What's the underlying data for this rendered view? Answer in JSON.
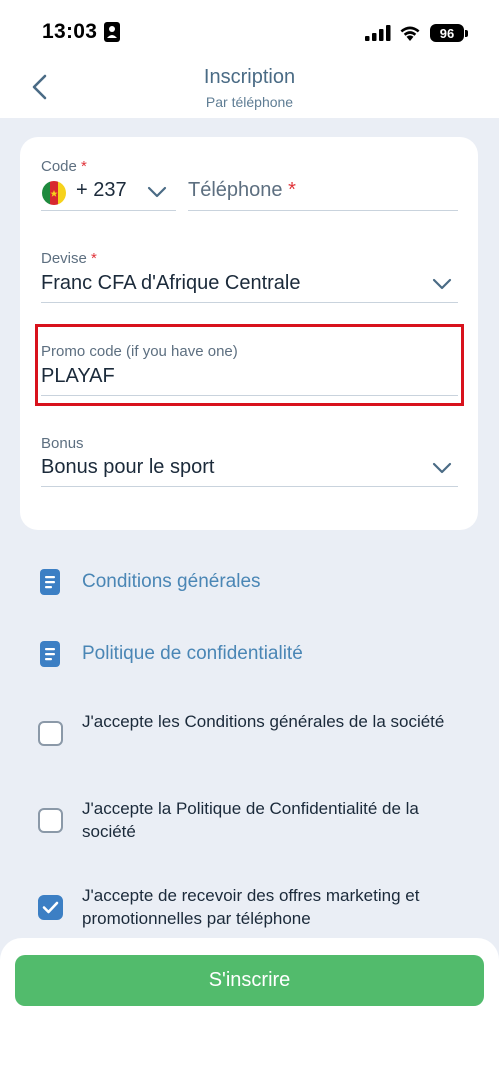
{
  "status_bar": {
    "time": "13:03",
    "battery": "96"
  },
  "header": {
    "title": "Inscription",
    "subtitle": "Par téléphone"
  },
  "form": {
    "code_label": "Code",
    "code_value": "+ 237",
    "phone_placeholder": "Téléphone",
    "required_mark": "*",
    "currency_label": "Devise",
    "currency_value": "Franc CFA d'Afrique Centrale",
    "promo_label": "Promo code (if you have one)",
    "promo_value": "PLAYAF",
    "bonus_label": "Bonus",
    "bonus_value": "Bonus pour le sport"
  },
  "links": [
    {
      "label": "Conditions générales"
    },
    {
      "label": "Politique de confidentialité"
    }
  ],
  "checkboxes": [
    {
      "label": "J'accepte les Conditions générales de la société",
      "checked": false
    },
    {
      "label": "J'accepte la Politique de Confidentialité de la société",
      "checked": false
    },
    {
      "label": "J'accepte de recevoir des offres marketing et promotionnelles par téléphone",
      "checked": true
    }
  ],
  "submit": {
    "label": "S'inscrire"
  },
  "colors": {
    "accent": "#4a86b5",
    "submit": "#52bb6c",
    "highlight": "#d8121c",
    "checked": "#3c7fc4"
  }
}
